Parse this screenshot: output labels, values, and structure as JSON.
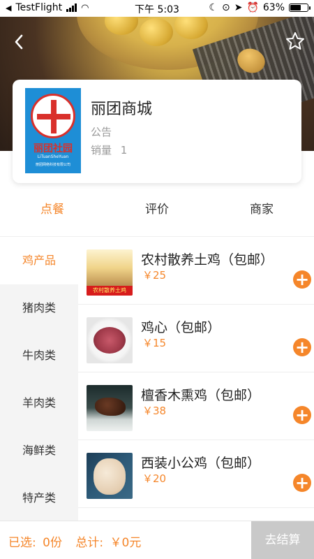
{
  "status_bar": {
    "carrier": "TestFlight",
    "time": "下午 5:03",
    "battery": "63%",
    "battery_level": 0.63
  },
  "header": {
    "back_icon": "chevron-left-icon",
    "favorite_icon": "star-outline-icon"
  },
  "shop": {
    "name": "丽团商城",
    "notice_label": "公告",
    "sales_label": "销量",
    "sales_value": "1",
    "logo": {
      "brand_cn": "丽团社园",
      "brand_en": "LiTuanSheYuan",
      "company": "丽团网络科技有限公司"
    }
  },
  "tabs": [
    {
      "label": "点餐",
      "active": true
    },
    {
      "label": "评价",
      "active": false
    },
    {
      "label": "商家",
      "active": false
    }
  ],
  "categories": [
    {
      "label": "鸡产品",
      "active": true
    },
    {
      "label": "猪肉类",
      "active": false
    },
    {
      "label": "牛肉类",
      "active": false
    },
    {
      "label": "羊肉类",
      "active": false
    },
    {
      "label": "海鲜类",
      "active": false
    },
    {
      "label": "特产类",
      "active": false
    }
  ],
  "products": [
    {
      "name": "农村散养土鸡（包邮）",
      "price": "￥25",
      "image_label": "农村散养土鸡"
    },
    {
      "name": "鸡心（包邮）",
      "price": "￥15"
    },
    {
      "name": "檀香木熏鸡（包邮）",
      "price": "￥38"
    },
    {
      "name": "西装小公鸡（包邮）",
      "price": "￥20"
    }
  ],
  "cart": {
    "selected_label": "已选:",
    "selected_value": "0份",
    "total_label": "总计:",
    "total_value": "￥0元",
    "checkout_label": "去结算"
  },
  "colors": {
    "accent": "#f5862a",
    "checkout_disabled": "#c9c9c9"
  }
}
